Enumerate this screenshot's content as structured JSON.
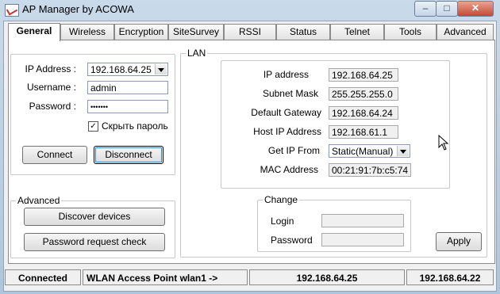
{
  "window": {
    "title": "AP Manager by ACOWA",
    "minimize": "–",
    "maximize": "□",
    "close": "✕"
  },
  "tabs": [
    {
      "label": "General",
      "active": true
    },
    {
      "label": "Wireless"
    },
    {
      "label": "Encryption"
    },
    {
      "label": "SiteSurvey"
    },
    {
      "label": "RSSI"
    },
    {
      "label": "Status"
    },
    {
      "label": "Telnet"
    },
    {
      "label": "Tools"
    },
    {
      "label": "Advanced"
    }
  ],
  "login": {
    "ip_label": "IP Address :",
    "ip_value": "192.168.64.25",
    "username_label": "Username :",
    "username_value": "admin",
    "password_label": "Password :",
    "password_value": "•••••••",
    "hide_password_label": "Скрыть пароль",
    "hide_password_checked": "✓",
    "connect": "Connect",
    "disconnect": "Disconnect"
  },
  "advanced": {
    "legend": "Advanced",
    "discover": "Discover devices",
    "password_request": "Password request check"
  },
  "lan": {
    "legend": "LAN",
    "ip_address_label": "IP address",
    "ip_address": "192.168.64.25",
    "subnet_mask_label": "Subnet Mask",
    "subnet_mask": "255.255.255.0",
    "gateway_label": "Default Gateway",
    "gateway": "192.168.64.24",
    "host_ip_label": "Host IP Address",
    "host_ip": "192.168.61.1",
    "get_ip_label": "Get IP From",
    "get_ip": "Static(Manual)",
    "mac_label": "MAC Address",
    "mac": "00:21:91:7b:c5:74"
  },
  "change": {
    "legend": "Change",
    "login_label": "Login",
    "login_value": "",
    "password_label": "Password",
    "password_value": ""
  },
  "apply": "Apply",
  "status": {
    "connection": "Connected",
    "device": "WLAN Access Point wlan1 ->",
    "device_ip": "192.168.64.25",
    "host_ip": "192.168.64.22"
  }
}
